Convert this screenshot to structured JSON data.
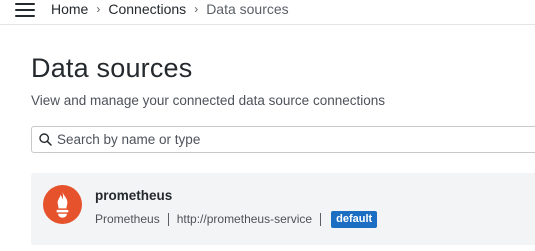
{
  "topbar": {
    "menu_icon": "hamburger-menu-icon",
    "breadcrumb": {
      "items": [
        "Home",
        "Connections"
      ],
      "current": "Data sources",
      "separator": "›"
    }
  },
  "page": {
    "title": "Data sources",
    "subtitle": "View and manage your connected data source connections"
  },
  "search": {
    "placeholder": "Search by name or type",
    "value": "",
    "icon": "search-icon"
  },
  "datasources": [
    {
      "name": "prometheus",
      "type": "Prometheus",
      "url": "http://prometheus-service",
      "badge": "default",
      "icon": "prometheus-logo",
      "logo_color": "#e6522c",
      "badge_color": "#1b6ec2"
    }
  ]
}
